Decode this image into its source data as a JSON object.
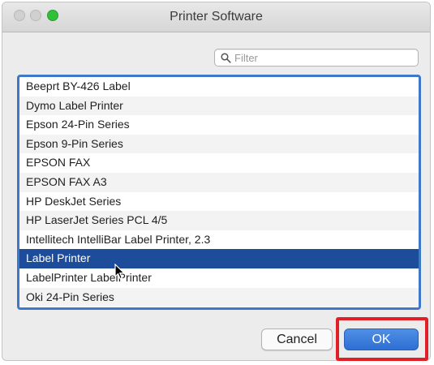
{
  "window": {
    "title": "Printer Software",
    "accent_color": "#3e78c8",
    "selection_color": "#1d4d9a",
    "highlight_color": "#e11f26"
  },
  "filter": {
    "placeholder": "Filter",
    "value": ""
  },
  "printers": [
    "Beeprt BY-426 Label",
    "Dymo Label Printer",
    "Epson 24-Pin Series",
    "Epson 9-Pin Series",
    "EPSON FAX",
    "EPSON FAX A3",
    "HP DeskJet Series",
    "HP LaserJet Series PCL 4/5",
    "Intellitech IntelliBar Label Printer, 2.3",
    "Label Printer",
    "LabelPrinter LabelPrinter",
    "Oki 24-Pin Series"
  ],
  "selected_index": 9,
  "buttons": {
    "cancel": "Cancel",
    "ok": "OK"
  }
}
